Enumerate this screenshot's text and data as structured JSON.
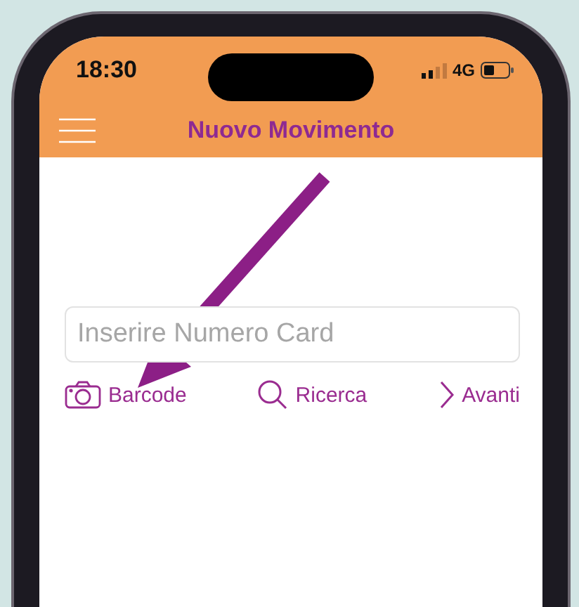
{
  "status_bar": {
    "time": "18:30",
    "network": "4G"
  },
  "header": {
    "title": "Nuovo Movimento"
  },
  "card_field": {
    "placeholder": "Inserire Numero Card"
  },
  "actions": [
    {
      "label": "Barcode",
      "kind": "camera"
    },
    {
      "label": "Ricerca",
      "kind": "search"
    },
    {
      "label": "Avanti",
      "kind": "next"
    }
  ]
}
